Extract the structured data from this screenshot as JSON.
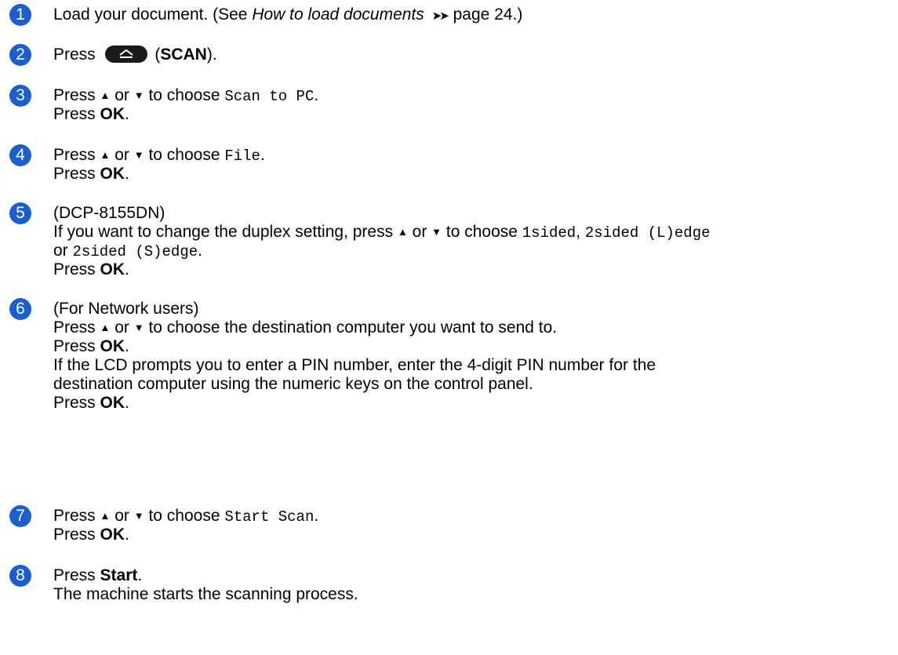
{
  "colors": {
    "badge": "#1a5fd1"
  },
  "triangles": {
    "up": "▲",
    "down": "▼"
  },
  "steps": [
    {
      "num": "1",
      "load_text": "Load your document. (See ",
      "load_link": "How to load documents",
      "arrow": "➤➤",
      "load_page": " page 24.)"
    },
    {
      "num": "2",
      "press": "Press ",
      "scan_paren_open": " (",
      "scan_label": "SCAN",
      "scan_paren_close": ")."
    },
    {
      "num": "3",
      "press": "Press ",
      "or": " or ",
      "to_choose": " to choose ",
      "option": "Scan to PC",
      "period": ".",
      "press2": "Press ",
      "ok": "OK",
      "ok_period": "."
    },
    {
      "num": "4",
      "press": "Press ",
      "or": " or ",
      "to_choose": " to choose ",
      "option": "File",
      "period": ".",
      "press2": "Press ",
      "ok": "OK",
      "ok_period": "."
    },
    {
      "num": "5",
      "model": "(DCP-8155DN)",
      "text": "If you want to change the duplex setting, press ",
      "or": " or ",
      "to_choose": " to choose ",
      "opt1": "1sided",
      "comma": ", ",
      "opt2": "2sided (L)edge",
      "or2": "or ",
      "opt3": "2sided (S)edge",
      "period": ".",
      "press2": "Press ",
      "ok": "OK",
      "ok_period": "."
    },
    {
      "num": "6",
      "heading": "(For Network users)",
      "press": "Press ",
      "or": " or ",
      "to_choose_dest": " to choose the destination computer you want to send to.",
      "press2": "Press ",
      "ok": "OK",
      "ok_period": ".",
      "pin1": "If the LCD prompts you to enter a PIN number, enter the 4-digit PIN number for the",
      "pin2": "destination computer using the numeric keys on the control panel.",
      "press3": "Press ",
      "ok2": "OK",
      "ok2_period": "."
    },
    {
      "num": "7",
      "press": "Press ",
      "or": " or ",
      "to_choose": " to choose ",
      "option": "Start Scan",
      "period": ".",
      "press2": "Press ",
      "ok": "OK",
      "ok_period": "."
    },
    {
      "num": "8",
      "press": "Press ",
      "start": "Start",
      "period": ".",
      "result": "The machine starts the scanning process."
    }
  ]
}
